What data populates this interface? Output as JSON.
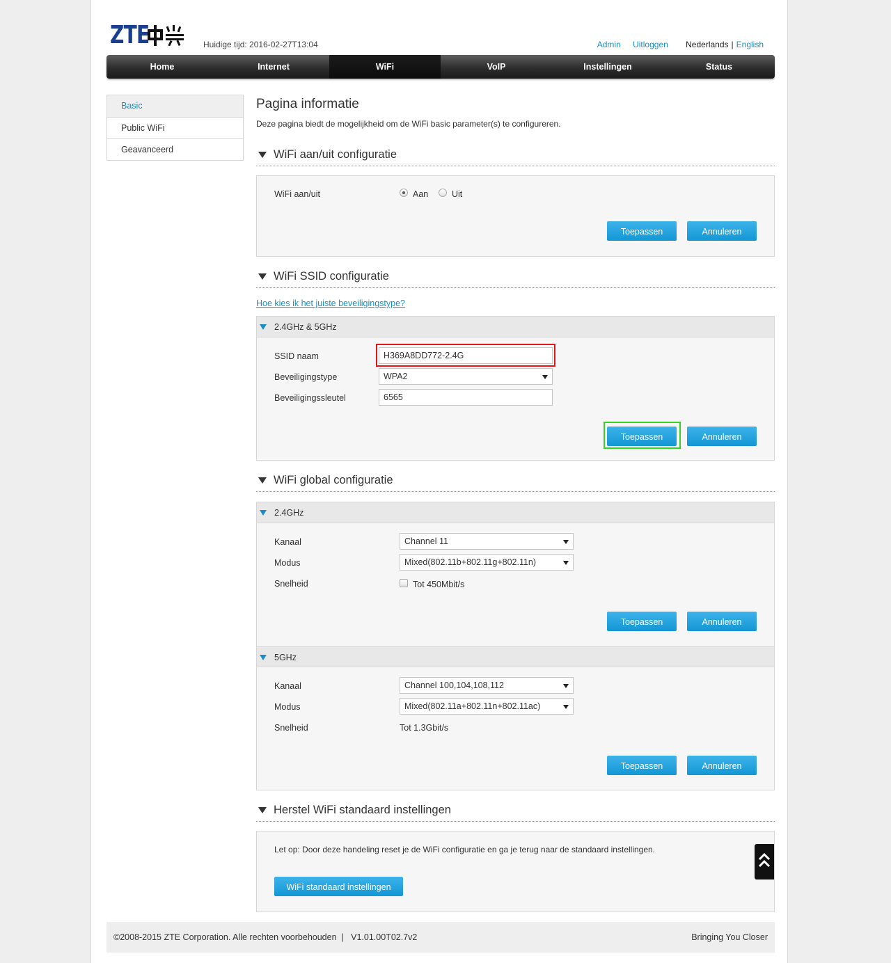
{
  "header": {
    "logo_text": "ZTE中兴",
    "time_label": "Huidige tijd: 2016-02-27T13:04",
    "admin_link": "Admin",
    "logout_link": "Uitloggen",
    "lang_current": "Nederlands",
    "lang_separator": "|",
    "lang_other": "English"
  },
  "nav": {
    "items": [
      {
        "label": "Home"
      },
      {
        "label": "Internet"
      },
      {
        "label": "WiFi"
      },
      {
        "label": "VoIP"
      },
      {
        "label": "Instellingen"
      },
      {
        "label": "Status"
      }
    ],
    "active": "WiFi"
  },
  "sidebar": {
    "items": [
      {
        "label": "Basic"
      },
      {
        "label": "Public WiFi"
      },
      {
        "label": "Geavanceerd"
      }
    ],
    "active": "Basic"
  },
  "main": {
    "title": "Pagina informatie",
    "description": "Deze pagina biedt de mogelijkheid om de WiFi basic parameter(s) te configureren.",
    "onoff": {
      "section_title": "WiFi aan/uit configuratie",
      "label": "WiFi aan/uit",
      "option_on": "Aan",
      "option_off": "Uit",
      "selected": "Aan",
      "apply": "Toepassen",
      "cancel": "Annuleren"
    },
    "ssid": {
      "section_title": "WiFi SSID configuratie",
      "help_link": "Hoe kies ik het juiste beveiligingstype?",
      "band_header": "2.4GHz & 5GHz",
      "name_label": "SSID naam",
      "name_value": "H369A8DD772-2.4G",
      "security_label": "Beveiligingstype",
      "security_value": "WPA2",
      "key_label": "Beveiligingssleutel",
      "key_value": "6565",
      "apply": "Toepassen",
      "cancel": "Annuleren"
    },
    "global": {
      "section_title": "WiFi global configuratie",
      "band24": {
        "header": "2.4GHz",
        "channel_label": "Kanaal",
        "channel_value": "Channel 11",
        "mode_label": "Modus",
        "mode_value": "Mixed(802.11b+802.11g+802.11n)",
        "speed_label": "Snelheid",
        "speed_value": "Tot 450Mbit/s",
        "speed_checked": false,
        "apply": "Toepassen",
        "cancel": "Annuleren"
      },
      "band5": {
        "header": "5GHz",
        "channel_label": "Kanaal",
        "channel_value": "Channel 100,104,108,112",
        "mode_label": "Modus",
        "mode_value": "Mixed(802.11a+802.11n+802.11ac)",
        "speed_label": "Snelheid",
        "speed_value": "Tot 1.3Gbit/s",
        "apply": "Toepassen",
        "cancel": "Annuleren"
      }
    },
    "reset": {
      "section_title": "Herstel WiFi standaard instellingen",
      "note": "Let op: Door deze handeling reset je de WiFi configuratie en ga je terug naar de standaard instellingen.",
      "button": "WiFi standaard instellingen"
    }
  },
  "footer": {
    "copyright": "©2008-2015 ZTE Corporation. Alle rechten voorbehouden  |   V1.01.00T02.7v2",
    "slogan": "Bringing You Closer"
  },
  "colors": {
    "accent": "#1a8fc4",
    "button": "#1fa3dd",
    "highlight_red": "#e0161d",
    "highlight_green": "#35d422"
  },
  "icons": [
    "triangle-down-icon",
    "dropdown-arrow-icon",
    "scroll-top-icon"
  ]
}
